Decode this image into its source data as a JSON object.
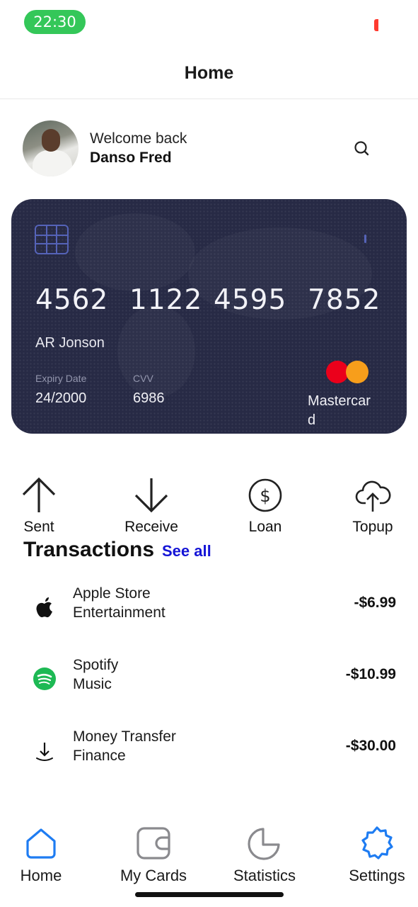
{
  "status_bar": {
    "time": "22:30",
    "colors": {
      "time_pill": "#34c759",
      "battery": "#ff3b30"
    }
  },
  "header": {
    "title": "Home"
  },
  "profile": {
    "welcome": "Welcome back",
    "name": "Danso Fred",
    "avatar_icon": "user-avatar",
    "search_icon": "search-icon"
  },
  "card": {
    "number_groups": [
      "4562",
      "1122",
      "4595",
      "7852"
    ],
    "holder": "AR Jonson",
    "expiry_label": "Expiry Date",
    "expiry_value": "24/2000",
    "cvv_label": "CVV",
    "cvv_value": "6986",
    "brand": "Mastercard",
    "colors": {
      "background": "#272a45",
      "mc_red": "#eb001b",
      "mc_orange": "#f79e1b",
      "chip": "#5563b8"
    }
  },
  "actions": [
    {
      "label": "Sent",
      "icon": "arrow-up-icon"
    },
    {
      "label": "Receive",
      "icon": "arrow-down-icon"
    },
    {
      "label": "Loan",
      "icon": "dollar-circle-icon"
    },
    {
      "label": "Topup",
      "icon": "cloud-upload-icon"
    }
  ],
  "transactions": {
    "title": "Transactions",
    "see_all": "See all",
    "items": [
      {
        "name": "Apple Store",
        "category": "Entertainment",
        "amount": "-$6.99",
        "icon": "apple-icon"
      },
      {
        "name": "Spotify",
        "category": "Music",
        "amount": "-$10.99",
        "icon": "spotify-icon"
      },
      {
        "name": "Money Transfer",
        "category": "Finance",
        "amount": "-$30.00",
        "icon": "download-icon"
      }
    ]
  },
  "tabs": [
    {
      "label": "Home",
      "icon": "home-icon",
      "active": true
    },
    {
      "label": "My Cards",
      "icon": "wallet-icon",
      "active": false
    },
    {
      "label": "Statistics",
      "icon": "pie-chart-icon",
      "active": false
    },
    {
      "label": "Settings",
      "icon": "gear-icon",
      "active": false
    }
  ],
  "accent_color": "#1e7cf2"
}
